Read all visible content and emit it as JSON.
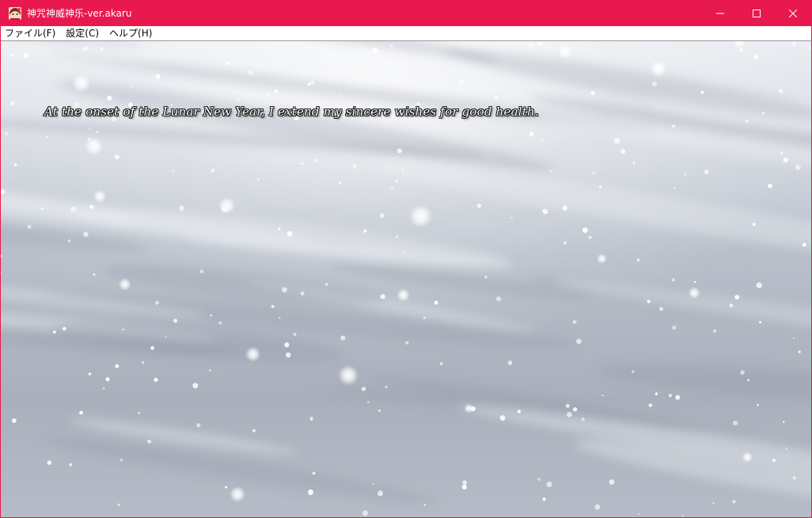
{
  "window": {
    "title": "神咒神威神乐-ver.akaru",
    "app_icon": "game-character-icon",
    "accent_color": "#e8194e",
    "controls": {
      "minimize_icon": "minimize-icon",
      "maximize_icon": "maximize-icon",
      "close_icon": "close-icon"
    }
  },
  "menubar": {
    "items": [
      {
        "label": "ファイル(F)"
      },
      {
        "label": "設定(C)"
      },
      {
        "label": "ヘルプ(H)"
      }
    ]
  },
  "scene": {
    "background": "snowy-cloudy-sky",
    "message_text": "At the onset of the Lunar New Year, I extend my sincere wishes for good health."
  }
}
